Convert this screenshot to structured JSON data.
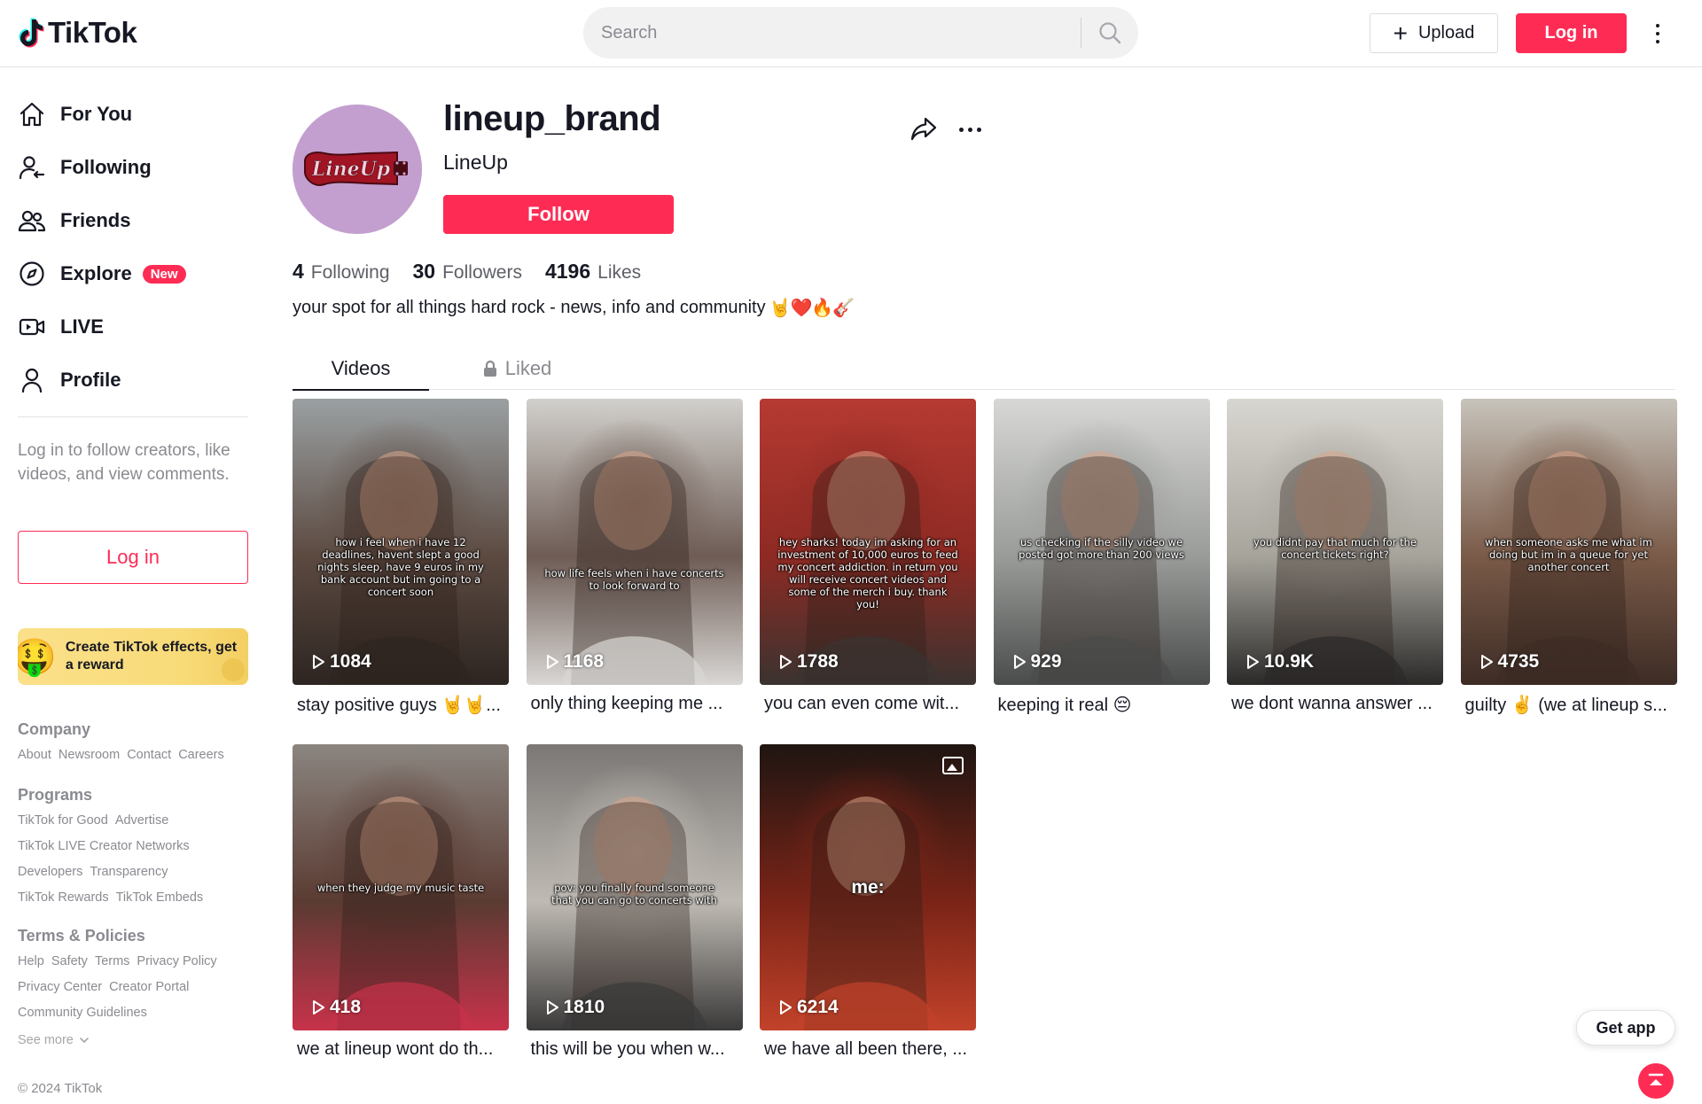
{
  "header": {
    "logo_text": "TikTok",
    "search_placeholder": "Search",
    "upload_label": "Upload",
    "login_label": "Log in"
  },
  "sidebar": {
    "nav": [
      {
        "label": "For You",
        "icon": "home-icon"
      },
      {
        "label": "Following",
        "icon": "following-icon"
      },
      {
        "label": "Friends",
        "icon": "friends-icon"
      },
      {
        "label": "Explore",
        "icon": "compass-icon",
        "badge": "New"
      },
      {
        "label": "LIVE",
        "icon": "live-icon"
      },
      {
        "label": "Profile",
        "icon": "profile-icon"
      }
    ],
    "login_hint": "Log in to follow creators, like videos, and view comments.",
    "login_button": "Log in",
    "effects_banner": "Create TikTok effects, get a reward",
    "footer": {
      "company_title": "Company",
      "company_links": [
        "About",
        "Newsroom",
        "Contact",
        "Careers"
      ],
      "programs_title": "Programs",
      "programs_links": [
        "TikTok for Good",
        "Advertise",
        "TikTok LIVE Creator Networks",
        "Developers",
        "Transparency",
        "TikTok Rewards",
        "TikTok Embeds"
      ],
      "terms_title": "Terms & Policies",
      "terms_links": [
        "Help",
        "Safety",
        "Terms",
        "Privacy Policy",
        "Privacy Center",
        "Creator Portal",
        "Community Guidelines"
      ],
      "see_more": "See more",
      "copyright": "© 2024 TikTok"
    }
  },
  "profile": {
    "username": "lineup_brand",
    "nickname": "LineUp",
    "follow_label": "Follow",
    "avatar_text": "LineUp",
    "stats": [
      {
        "value": "4",
        "label": "Following"
      },
      {
        "value": "30",
        "label": "Followers"
      },
      {
        "value": "4196",
        "label": "Likes"
      }
    ],
    "bio": "your spot for all things hard rock - news, info and community",
    "bio_emojis": "🤘❤️🔥🎸"
  },
  "tabs": {
    "videos": "Videos",
    "liked": "Liked"
  },
  "videos": [
    {
      "views": "1084",
      "desc": "stay positive guys 🤘🤘...",
      "caption": "how i feel when i have 12 deadlines, havent slept a good nights sleep, have 9 euros in my bank account but im going to a concert soon",
      "colors": [
        "#9aa0a2",
        "#5c4a41",
        "#2d2521"
      ]
    },
    {
      "views": "1168",
      "desc": "only thing keeping me ...",
      "caption": "how life feels when i have concerts to look forward to",
      "colors": [
        "#d2d0cc",
        "#6e5c55",
        "#d9d7d4"
      ]
    },
    {
      "views": "1788",
      "desc": "you can even come wit...",
      "caption": "hey sharks! today im asking for an investment of 10,000 euros to feed my concert addiction. in return you will receive concert videos and some of the merch i buy. thank you!",
      "colors": [
        "#b53a32",
        "#8e2a23",
        "#3a3330"
      ]
    },
    {
      "views": "929",
      "desc": "keeping it real 😔",
      "caption": "us checking if the silly video we posted got more than 200 views",
      "colors": [
        "#d7d8d6",
        "#9a9c9a",
        "#4a4c4b"
      ]
    },
    {
      "views": "10.9K",
      "desc": "we dont wanna answer ...",
      "caption": "you didnt pay that much for the concert tickets right?",
      "colors": [
        "#d8d6d0",
        "#a7a49c",
        "#2b2a29"
      ]
    },
    {
      "views": "4735",
      "desc": "guilty ✌️ (we at lineup s...",
      "caption": "when someone asks me what im doing but im in a queue for yet another concert",
      "colors": [
        "#c7c3bb",
        "#7a5a48",
        "#3d2c25"
      ]
    },
    {
      "views": "418",
      "desc": "we at lineup wont do th...",
      "caption": "when they judge my music taste",
      "colors": [
        "#8b8580",
        "#5a3b32",
        "#c7324a"
      ]
    },
    {
      "views": "1810",
      "desc": "this will be you when w...",
      "caption": "pov: you finally found someone that you can go to concerts with",
      "colors": [
        "#7a7775",
        "#bfbab3",
        "#3b3a3a"
      ]
    },
    {
      "views": "6214",
      "desc": "we have all been there, ...",
      "caption": "",
      "overlay": "me:",
      "is_photo": true,
      "colors": [
        "#1f1512",
        "#7a2417",
        "#c2422a"
      ]
    }
  ],
  "floating": {
    "get_app": "Get app"
  },
  "colors": {
    "brand": "#fe2c55",
    "text": "#161823",
    "muted": "#8a8b91"
  }
}
